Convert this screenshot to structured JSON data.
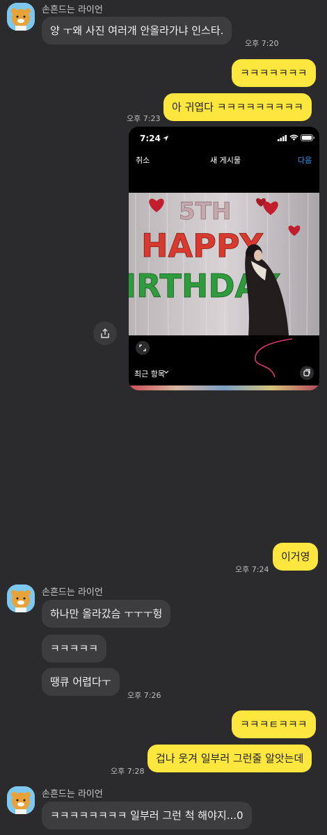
{
  "messages": {
    "sender_name": "손흔드는 라이언",
    "m1": "양 ㅜ왜 사진 여러개 안올라가냐 인스타.",
    "m1_time": "오후 7:20",
    "m2": "ㅋㅋㅋㅋㅋㅋㅋ",
    "m3": "아 귀엽다 ㅋㅋㅋㅋㅋㅋㅋㅋㅋ",
    "m3_time": "오후 7:23",
    "m4": "이거영",
    "m4_time": "오후 7:24",
    "m5": "하나만 올라갔슴 ㅜㅜㅜ헝",
    "m6": "ㅋㅋㅋㅋㅋ",
    "m7": "땡큐 어렵다ㅜ",
    "m7_time": "오후 7:26",
    "m8": "ㅋㅋㅋㅌㅋㅋㅋ",
    "m9": "겁나 웃겨 일부러 그런줄 알앗는데",
    "m9_time": "오후 7:28",
    "m10": "ㅋㅋㅋㅋㅋㅋㅋㅋ 일부러 그런 척 해야지...0"
  },
  "screenshot": {
    "clock": "7:24",
    "cancel": "취소",
    "title": "새 게시물",
    "next": "다음",
    "recent": "최근 항목",
    "balloon_row1": "5TH",
    "balloon_row2": "HAPPY",
    "balloon_row3": "IRTHDAY"
  },
  "colors": {
    "background": "#2b2b2d",
    "incoming_bubble": "#3d3d40",
    "outgoing_bubble": "#fde63d",
    "ig_accent": "#3897f0"
  },
  "icons": [
    "ryan-avatar-icon",
    "share-icon",
    "expand-icon",
    "multi-select-icon",
    "location-arrow-icon",
    "signal-icon",
    "wifi-icon",
    "battery-icon",
    "chevron-down-icon"
  ]
}
